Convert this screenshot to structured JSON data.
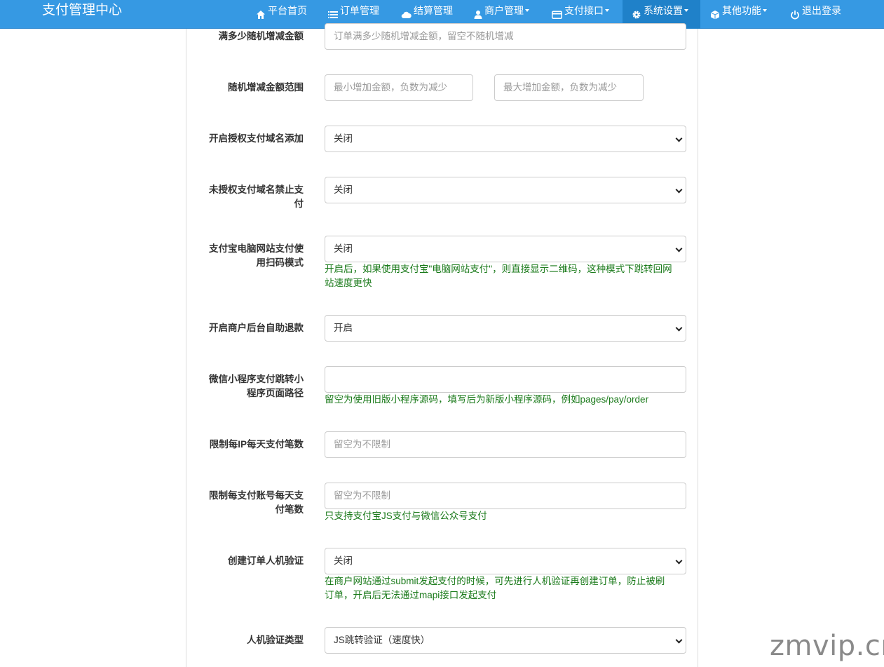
{
  "navbar": {
    "brand": "支付管理中心",
    "items": [
      {
        "label": "平台首页",
        "icon": "home-icon"
      },
      {
        "label": "订单管理",
        "icon": "list-icon"
      },
      {
        "label": "结算管理",
        "icon": "cloud-icon"
      },
      {
        "label": "商户管理",
        "icon": "user-icon"
      },
      {
        "label": "支付接口",
        "icon": "credit-card-icon"
      },
      {
        "label": "系统设置",
        "icon": "gear-icon"
      },
      {
        "label": "其他功能",
        "icon": "cube-icon"
      },
      {
        "label": "退出登录",
        "icon": "power-icon"
      }
    ]
  },
  "form": {
    "random_amount": {
      "label": "满多少随机增减金额",
      "placeholder": "订单满多少随机增减金额，留空不随机增减"
    },
    "random_range": {
      "label": "随机增减金额范围",
      "min_placeholder": "最小增加金额，负数为减少",
      "max_placeholder": "最大增加金额，负数为减少"
    },
    "auth_domain_add": {
      "label": "开启授权支付域名添加",
      "value": "关闭"
    },
    "unauth_domain_ban": {
      "label_line1": "未授权支付域名禁止支",
      "label_line2": "付",
      "value": "关闭"
    },
    "alipay_qr_mode": {
      "label_line1": "支付宝电脑网站支付使",
      "label_line2": "用扫码模式",
      "value": "关闭",
      "help_line1": "开启后，如果使用支付宝\"电脑网站支付\"，则直接显示二维码，这种模式下跳转回网",
      "help_line2": "站速度更快"
    },
    "self_refund": {
      "label": "开启商户后台自助退款",
      "value": "开启"
    },
    "wx_mini_path": {
      "label_line1": "微信小程序支付跳转小",
      "label_line2": "程序页面路径",
      "value": "",
      "help": "留空为使用旧版小程序源码，填写后为新版小程序源码，例如pages/pay/order"
    },
    "ip_limit": {
      "label": "限制每IP每天支付笔数",
      "placeholder": "留空为不限制"
    },
    "account_limit": {
      "label_line1": "限制每支付账号每天支",
      "label_line2": "付笔数",
      "placeholder": "留空为不限制",
      "help": "只支持支付宝JS支付与微信公众号支付"
    },
    "captcha": {
      "label": "创建订单人机验证",
      "value": "关闭",
      "help_line1": "在商户网站通过submit发起支付的时候，可先进行人机验证再创建订单，防止被刷",
      "help_line2": "订单，开启后无法通过mapi接口发起支付"
    },
    "captcha_type": {
      "label": "人机验证类型",
      "value": "JS跳转验证（速度快）"
    }
  },
  "watermark": "zmvip.cn"
}
